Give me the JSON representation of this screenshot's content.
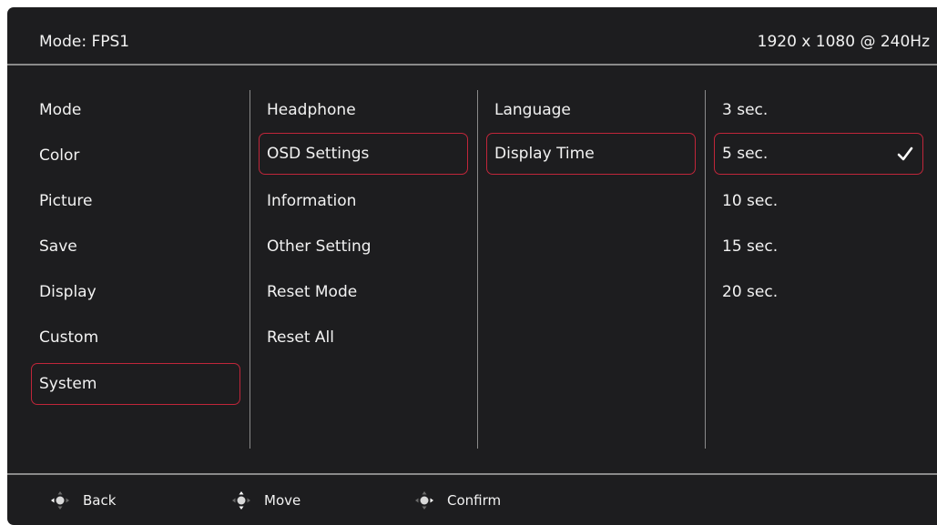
{
  "header": {
    "mode": "Mode: FPS1",
    "resolution": "1920 x 1080 @ 240Hz"
  },
  "menu1": [
    "Mode",
    "Color",
    "Picture",
    "Save",
    "Display",
    "Custom",
    "System"
  ],
  "menu2": [
    "Headphone",
    "OSD Settings",
    "Information",
    "Other Setting",
    "Reset Mode",
    "Reset All"
  ],
  "menu3": [
    "Language",
    "Display Time"
  ],
  "menu4": [
    "3 sec.",
    "5 sec.",
    "10 sec.",
    "15 sec.",
    "20 sec."
  ],
  "selected": {
    "menu1": "System",
    "menu2": "OSD Settings",
    "menu3": "Display Time",
    "menu4": "5 sec."
  },
  "footer": {
    "back": "Back",
    "move": "Move",
    "confirm": "Confirm"
  },
  "icons": {
    "checkmark": "checkmark-icon",
    "dpad": "dpad-icon"
  },
  "colors": {
    "background": "#1d1d1f",
    "selection": "#c0263a",
    "divider": "#8a8a8a",
    "text": "#f2f2f2"
  }
}
